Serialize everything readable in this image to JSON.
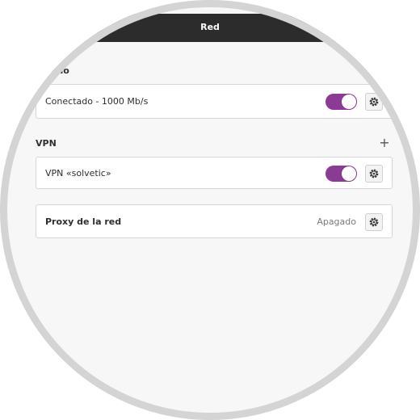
{
  "header": {
    "title": "Red"
  },
  "wired": {
    "heading": "…ado",
    "connection_label": "Conectado - 1000 Mb/s",
    "toggle_on": true
  },
  "vpn": {
    "heading": "VPN",
    "add_icon": "+",
    "connection_label": "VPN «solvetic»",
    "toggle_on": true
  },
  "proxy": {
    "label": "Proxy de la red",
    "status": "Apagado"
  },
  "colors": {
    "accent": "#8c3b94",
    "header_bg": "#2c2c2c",
    "page_bg": "#f7f7f7"
  },
  "icons": {
    "settings": "gear-icon",
    "add": "plus-icon"
  }
}
